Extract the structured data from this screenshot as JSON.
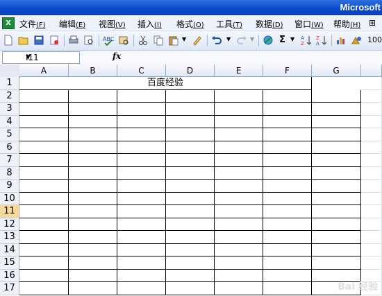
{
  "window": {
    "title": "Microsoft"
  },
  "menu": [
    {
      "label": "文件",
      "accel": "(F)"
    },
    {
      "label": "编辑",
      "accel": "(E)"
    },
    {
      "label": "视图",
      "accel": "(V)"
    },
    {
      "label": "插入",
      "accel": "(I)"
    },
    {
      "label": "格式",
      "accel": "(O)"
    },
    {
      "label": "工具",
      "accel": "(T)"
    },
    {
      "label": "数据",
      "accel": "(D)"
    },
    {
      "label": "窗口",
      "accel": "(W)"
    },
    {
      "label": "帮助",
      "accel": "(H)"
    }
  ],
  "toolbar": {
    "icons": [
      "new-icon",
      "open-icon",
      "save-icon",
      "permission-icon",
      "print-icon",
      "print-preview-icon",
      "spelling-icon",
      "research-icon",
      "cut-icon",
      "copy-icon",
      "paste-icon",
      "format-painter-icon",
      "undo-icon",
      "redo-icon",
      "hyperlink-icon",
      "autosum-icon",
      "sort-ascending-icon",
      "sort-descending-icon",
      "chart-wizard-icon",
      "drawing-icon"
    ],
    "sum_symbol": "Σ",
    "zoom": "100"
  },
  "formula_bar": {
    "cell_ref": "I11",
    "fx_label": "fx",
    "value": ""
  },
  "sheet": {
    "columns": [
      "A",
      "B",
      "C",
      "D",
      "E",
      "F",
      "G"
    ],
    "rows": [
      "1",
      "2",
      "3",
      "4",
      "5",
      "6",
      "7",
      "8",
      "9",
      "10",
      "11",
      "12",
      "13",
      "14",
      "15",
      "16",
      "17"
    ],
    "active_row": "11",
    "title_cell": "百度经验"
  },
  "watermark": "Bai 经验"
}
